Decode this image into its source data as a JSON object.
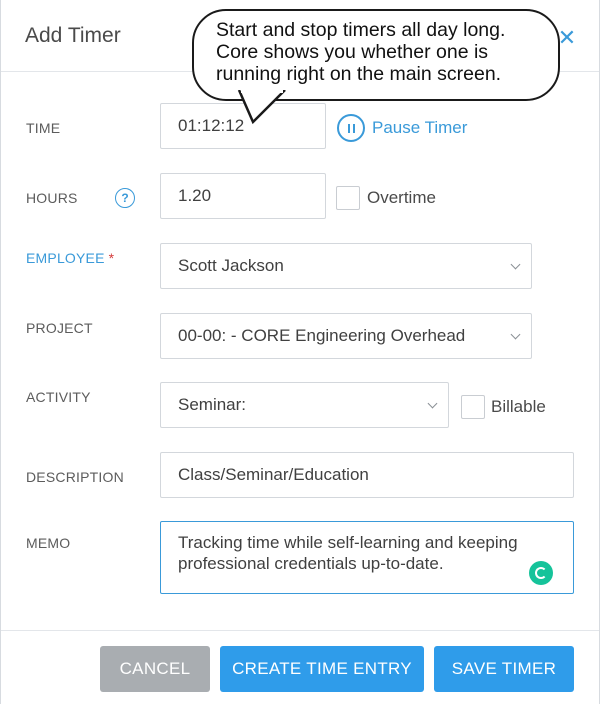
{
  "header": {
    "title": "Add Timer",
    "close_icon": "close-icon"
  },
  "form": {
    "time": {
      "label": "TIME",
      "value": "01:12:12",
      "pause_label": "Pause Timer"
    },
    "hours": {
      "label": "HOURS",
      "help_glyph": "?",
      "value": "1.20",
      "overtime_label": "Overtime",
      "overtime_checked": false
    },
    "employee": {
      "label": "EMPLOYEE",
      "required": "*",
      "value": "Scott Jackson"
    },
    "project": {
      "label": "PROJECT",
      "value": "00-00: - CORE Engineering Overhead"
    },
    "activity": {
      "label": "ACTIVITY",
      "value": "Seminar:",
      "billable_label": "Billable",
      "billable_checked": false
    },
    "description": {
      "label": "DESCRIPTION",
      "value": "Class/Seminar/Education"
    },
    "memo": {
      "label": "MEMO",
      "value": "Tracking time while self-learning and keeping professional credentials up-to-date."
    }
  },
  "footer": {
    "cancel_label": "CANCEL",
    "create_label": "CREATE TIME ENTRY",
    "save_label": "SAVE TIMER"
  },
  "callout": {
    "text_line1": "Start and stop timers all day long.",
    "text_line2": "Core shows you whether one is",
    "text_line3": "running right on the main screen."
  },
  "colors": {
    "accent": "#3a9ad9",
    "primary_button": "#2f9cea",
    "cancel_button": "#a9adb1",
    "required": "#d43b3b",
    "grammar": "#15c39a"
  }
}
